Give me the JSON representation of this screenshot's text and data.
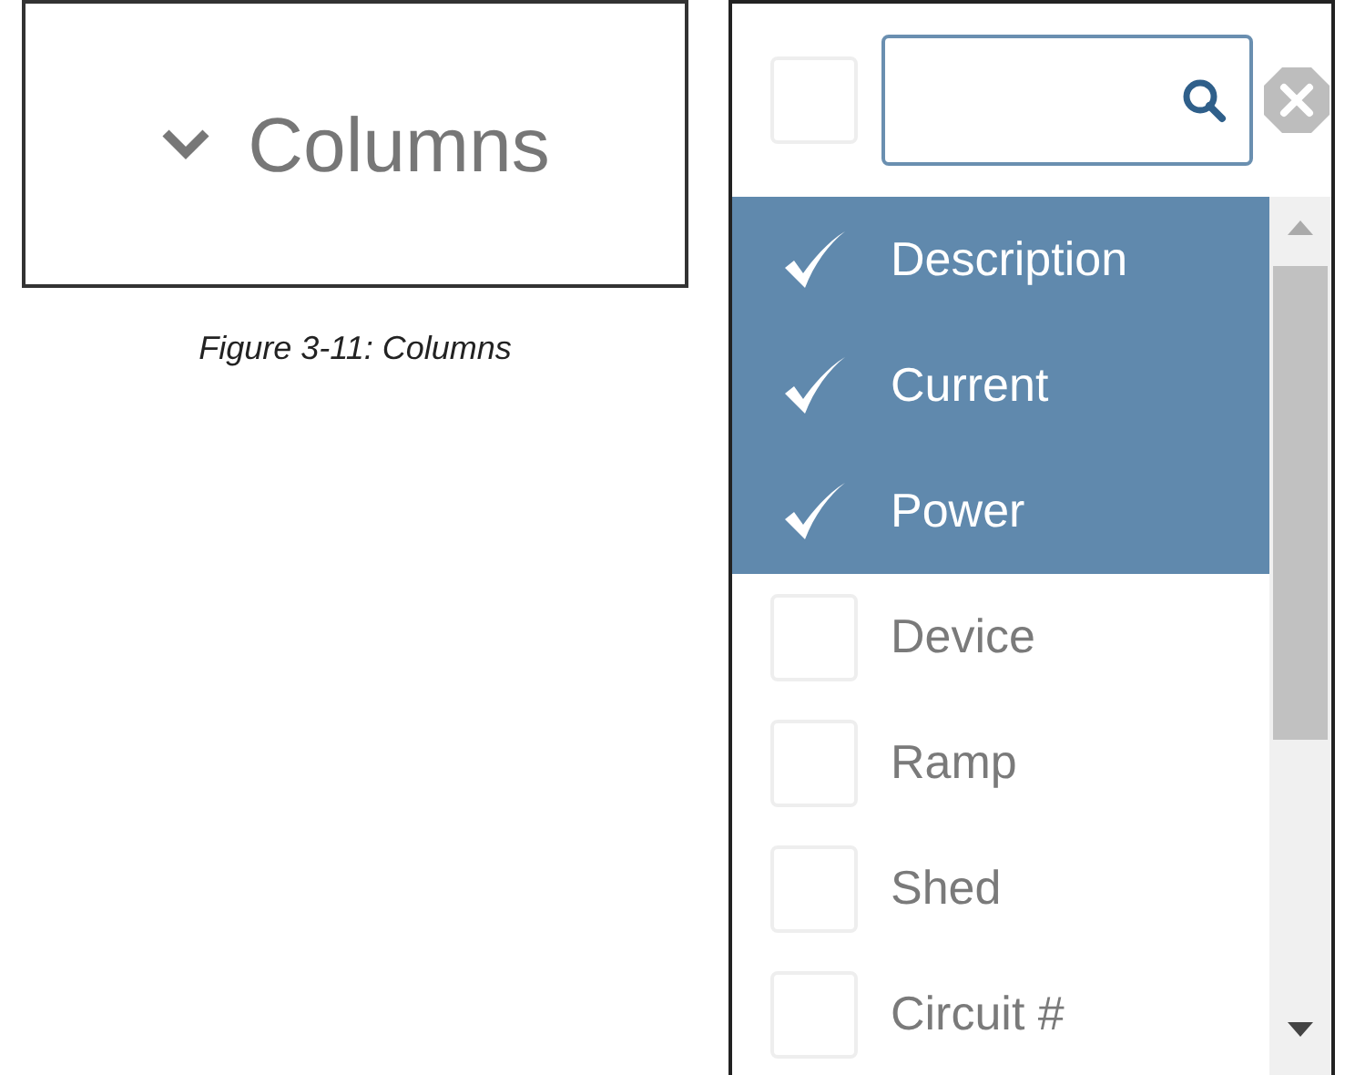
{
  "columns_button": {
    "label": "Columns"
  },
  "caption": "Figure 3-11: Columns",
  "column_picker": {
    "select_all": {
      "checked": false
    },
    "items": [
      {
        "label": "Description",
        "checked": true
      },
      {
        "label": "Current",
        "checked": true
      },
      {
        "label": "Power",
        "checked": true
      },
      {
        "label": "Device",
        "checked": false
      },
      {
        "label": "Ramp",
        "checked": false
      },
      {
        "label": "Shed",
        "checked": false
      },
      {
        "label": "Circuit #",
        "checked": false
      }
    ]
  }
}
